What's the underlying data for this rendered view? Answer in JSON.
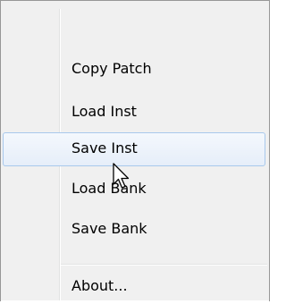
{
  "menu": {
    "items": [
      {
        "label": "Copy Patch",
        "state": "normal"
      },
      {
        "label": "Load Inst",
        "state": "normal"
      },
      {
        "label": "Save Inst",
        "state": "highlighted"
      },
      {
        "label": "Load Bank",
        "state": "normal"
      },
      {
        "label": "Save Bank",
        "state": "normal"
      }
    ],
    "footer_items": [
      {
        "label": "About...",
        "state": "normal"
      }
    ]
  },
  "colors": {
    "menu_background": "#f0f0f0",
    "highlight_border": "#a8c8ec",
    "highlight_fill": "#e6eef9",
    "separator": "#e2e3e3",
    "text": "#000000"
  },
  "cursor": {
    "icon": "arrow-pointer-icon"
  }
}
